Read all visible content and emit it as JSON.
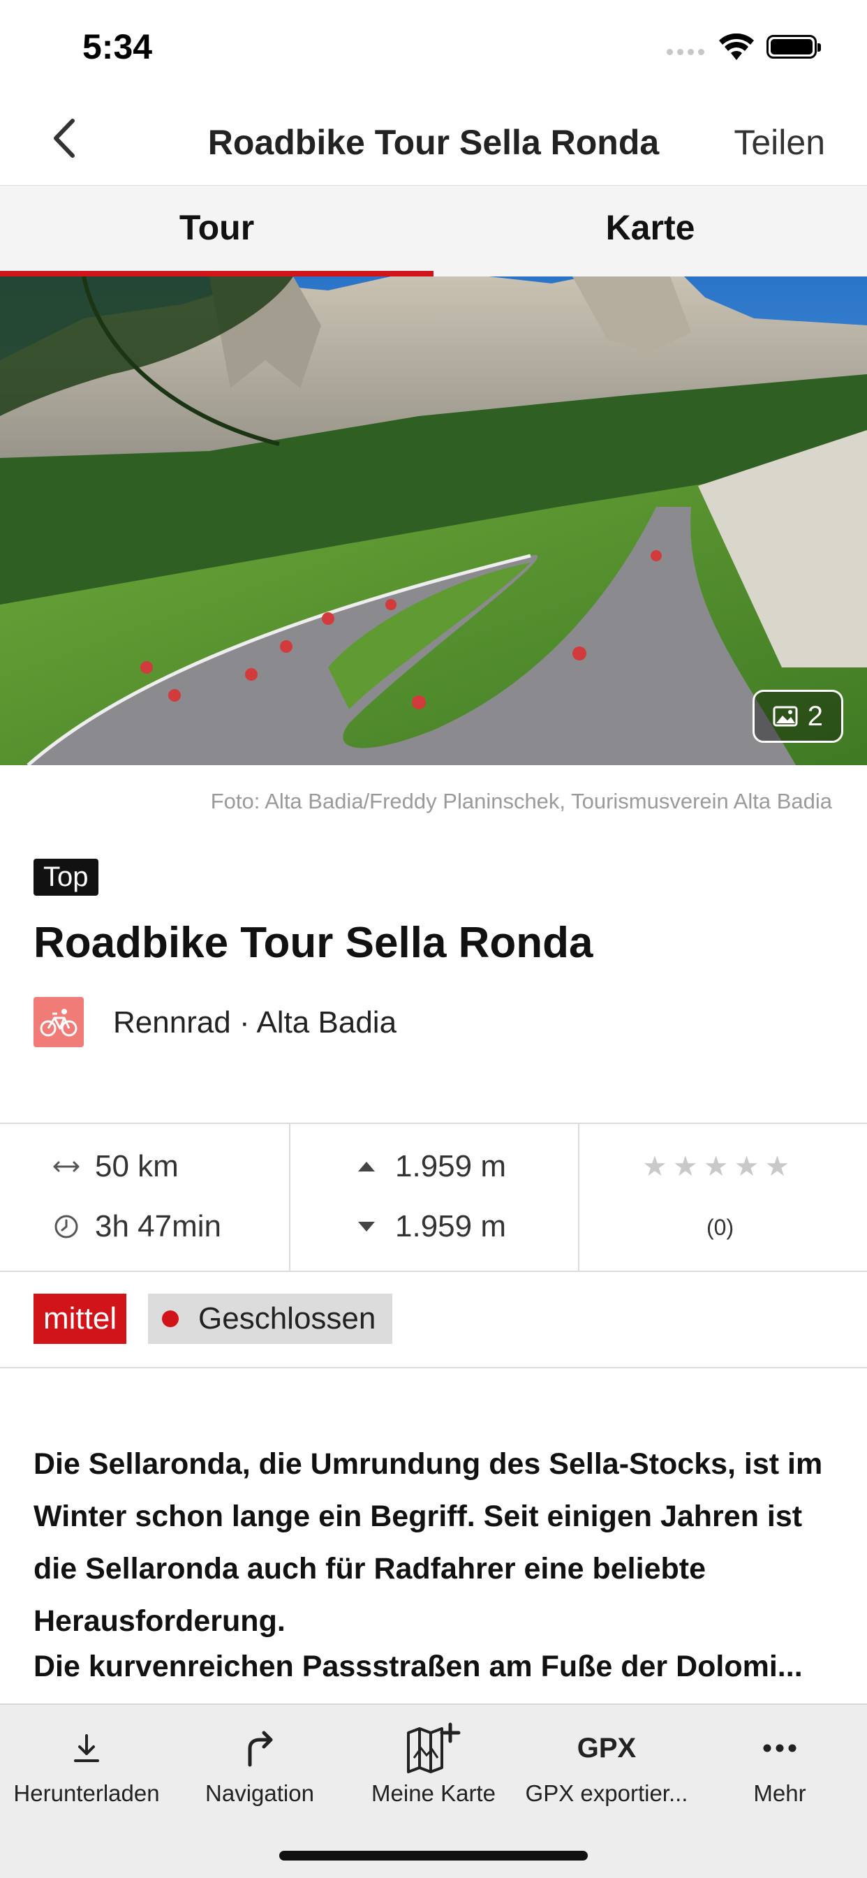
{
  "status_bar": {
    "time": "5:34"
  },
  "nav": {
    "title": "Roadbike Tour Sella Ronda",
    "share_label": "Teilen",
    "back_icon": "chevron-left-icon"
  },
  "tabs": [
    {
      "label": "Tour",
      "active": true
    },
    {
      "label": "Karte",
      "active": false
    }
  ],
  "hero": {
    "photo_count": "2",
    "credit": "Foto: Alta Badia/Freddy Planinschek, Tourismusverein Alta Badia"
  },
  "tour": {
    "badge": "Top",
    "title": "Roadbike Tour Sella Ronda",
    "category": "Rennrad · Alta Badia",
    "category_icon": "bike-icon"
  },
  "stats": {
    "distance": "50 km",
    "duration": "3h 47min",
    "ascent": "1.959 m",
    "descent": "1.959 m",
    "rating_stars": 0,
    "rating_max": 5,
    "rating_count": "(0)"
  },
  "tags": {
    "difficulty": "mittel",
    "status": "Geschlossen",
    "difficulty_color": "#d1141a",
    "status_dot_color": "#d1141a"
  },
  "description": "Die Sellaronda, die Umrundung des Sella-Stocks, ist im Winter schon lange ein Begriff. Seit einigen Jahren ist die Sellaronda auch für Radfahrer eine beliebte Herausforderung.",
  "description_line2": "Die kurvenreichen Passstraßen am Fuße der Dolomi...",
  "tabbar": [
    {
      "label": "Herunterladen",
      "icon": "download-icon"
    },
    {
      "label": "Navigation",
      "icon": "navigation-arrow-icon"
    },
    {
      "label": "Meine Karte",
      "icon": "map-add-icon"
    },
    {
      "label": "GPX exportier...",
      "icon": "gpx-icon",
      "icon_text": "GPX"
    },
    {
      "label": "Mehr",
      "icon": "more-dots-icon"
    }
  ],
  "colors": {
    "accent": "#d1141a"
  }
}
